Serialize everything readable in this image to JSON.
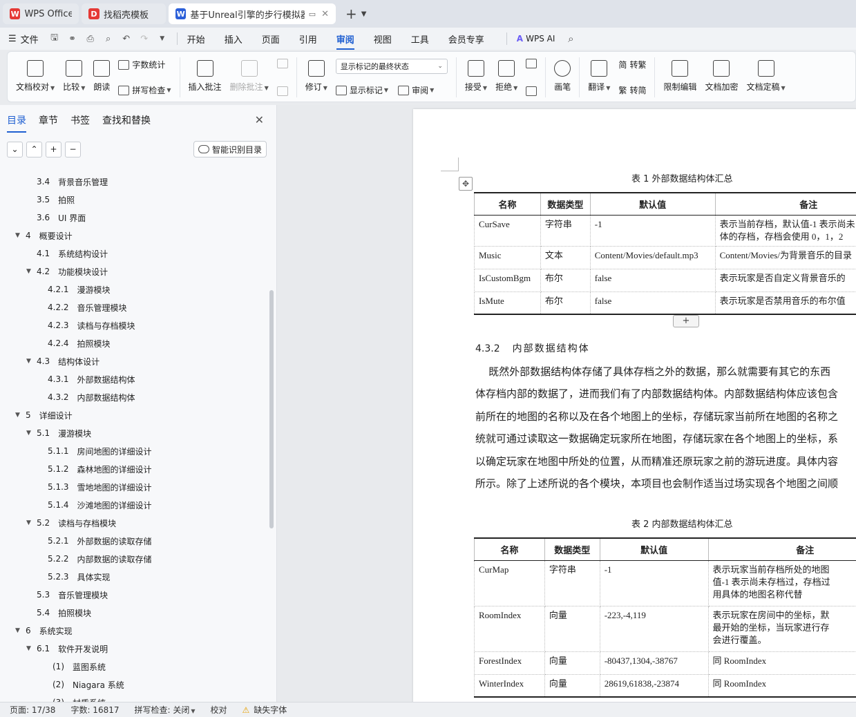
{
  "tabs": [
    {
      "label": "WPS Office",
      "icon": "wps-logo-icon",
      "color": "#e53935"
    },
    {
      "label": "找稻壳模板",
      "icon": "docer-logo-icon",
      "color": "#e53935"
    },
    {
      "label": "基于Unreal引擎的步行模拟器",
      "icon": "word-doc-icon",
      "color": "#2b5fd9"
    }
  ],
  "menu": {
    "file": "文件",
    "items": [
      "开始",
      "插入",
      "页面",
      "引用",
      "审阅",
      "视图",
      "工具",
      "会员专享"
    ],
    "active": "审阅",
    "wps_ai": "WPS AI"
  },
  "ribbon": {
    "doc_check": "文档校对",
    "compare": "比较",
    "read_aloud": "朗读",
    "word_count": "字数统计",
    "spell_check": "拼写检查",
    "insert_comment": "插入批注",
    "delete_comment": "删除批注",
    "revise": "修订",
    "markup_state": "显示标记的最终状态",
    "show_markup": "显示标记",
    "review": "审阅",
    "accept": "接受",
    "reject": "拒绝",
    "pen": "画笔",
    "translate": "翻译",
    "to_traditional": "转繁",
    "to_simplified": "转简",
    "restrict_edit": "限制编辑",
    "doc_encrypt": "文档加密",
    "doc_finalize": "文档定稿",
    "to_traditional_glyph": "简",
    "to_simplified_glyph": "繁"
  },
  "sidebar": {
    "tabs": [
      "目录",
      "章节",
      "书签",
      "查找和替换"
    ],
    "smart_toc": "智能识别目录",
    "toc": [
      {
        "num": "3.4",
        "text": "背景音乐管理",
        "level": 2
      },
      {
        "num": "3.5",
        "text": "拍照",
        "level": 2
      },
      {
        "num": "3.6",
        "text": "UI 界面",
        "level": 2
      },
      {
        "num": "4",
        "text": "概要设计",
        "level": 1,
        "expanded": true
      },
      {
        "num": "4.1",
        "text": "系统结构设计",
        "level": 2
      },
      {
        "num": "4.2",
        "text": "功能模块设计",
        "level": 2,
        "expanded": true
      },
      {
        "num": "4.2.1",
        "text": "漫游模块",
        "level": 3
      },
      {
        "num": "4.2.2",
        "text": "音乐管理模块",
        "level": 3
      },
      {
        "num": "4.2.3",
        "text": "读档与存档模块",
        "level": 3
      },
      {
        "num": "4.2.4",
        "text": "拍照模块",
        "level": 3
      },
      {
        "num": "4.3",
        "text": "结构体设计",
        "level": 2,
        "expanded": true
      },
      {
        "num": "4.3.1",
        "text": "外部数据结构体",
        "level": 3
      },
      {
        "num": "4.3.2",
        "text": "内部数据结构体",
        "level": 3
      },
      {
        "num": "5",
        "text": "详细设计",
        "level": 1,
        "expanded": true
      },
      {
        "num": "5.1",
        "text": "漫游模块",
        "level": 2,
        "expanded": true
      },
      {
        "num": "5.1.1",
        "text": "房间地图的详细设计",
        "level": 3
      },
      {
        "num": "5.1.2",
        "text": "森林地图的详细设计",
        "level": 3
      },
      {
        "num": "5.1.3",
        "text": "雪地地图的详细设计",
        "level": 3
      },
      {
        "num": "5.1.4",
        "text": "沙滩地图的详细设计",
        "level": 3
      },
      {
        "num": "5.2",
        "text": "读档与存档模块",
        "level": 2,
        "expanded": true
      },
      {
        "num": "5.2.1",
        "text": "外部数据的读取存储",
        "level": 3
      },
      {
        "num": "5.2.2",
        "text": "内部数据的读取存储",
        "level": 3
      },
      {
        "num": "5.2.3",
        "text": "具体实现",
        "level": 3
      },
      {
        "num": "5.3",
        "text": "音乐管理模块",
        "level": 2
      },
      {
        "num": "5.4",
        "text": "拍照模块",
        "level": 2
      },
      {
        "num": "6",
        "text": "系统实现",
        "level": 1,
        "expanded": true
      },
      {
        "num": "6.1",
        "text": "软件开发说明",
        "level": 2,
        "expanded": true
      },
      {
        "num": "(1)",
        "text": "蓝图系统",
        "level": 3
      },
      {
        "num": "(2)",
        "text": "Niagara 系统",
        "level": 3
      },
      {
        "num": "(3)",
        "text": "材质系统",
        "level": 3
      }
    ]
  },
  "document": {
    "table1": {
      "caption": "表 1  外部数据结构体汇总",
      "headers": [
        "名称",
        "数据类型",
        "默认值",
        "备注"
      ],
      "rows": [
        [
          "CurSave",
          "字符串",
          "-1",
          "表示当前存档，默认值-1 表示尚未\n体的存档，存档会使用 0，1，2"
        ],
        [
          "Music",
          "文本",
          "Content/Movies/default.mp3",
          "Content/Movies/为背景音乐的目录"
        ],
        [
          "IsCustomBgm",
          "布尔",
          "false",
          "表示玩家是否自定义背景音乐的"
        ],
        [
          "IsMute",
          "布尔",
          "false",
          "表示玩家是否禁用音乐的布尔值"
        ]
      ]
    },
    "section": {
      "num": "4.3.2",
      "title": "内部数据结构体"
    },
    "paragraph": [
      "    既然外部数据结构体存储了具体存档之外的数据，那么就需要有其它的东西",
      "体存档内部的数据了，进而我们有了内部数据结构体。内部数据结构体应该包含",
      "前所在的地图的名称以及在各个地图上的坐标，存储玩家当前所在地图的名称之",
      "统就可通过读取这一数据确定玩家所在地图，存储玩家在各个地图上的坐标，系",
      "以确定玩家在地图中所处的位置，从而精准还原玩家之前的游玩进度。具体内容",
      "所示。除了上述所说的各个模块，本项目也会制作适当过场实现各个地图之间顺"
    ],
    "table2": {
      "caption": "表 2  内部数据结构体汇总",
      "headers": [
        "名称",
        "数据类型",
        "默认值",
        "备注"
      ],
      "rows": [
        [
          "CurMap",
          "字符串",
          "-1",
          "表示玩家当前存档所处的地图\n值-1 表示尚未存档过，存档过\n用具体的地图名称代替"
        ],
        [
          "RoomIndex",
          "向量",
          "-223,-4,119",
          "表示玩家在房间中的坐标，默\n最开始的坐标，当玩家进行存\n会进行覆盖。"
        ],
        [
          "ForestIndex",
          "向量",
          "-80437,1304,-38767",
          "同 RoomIndex"
        ],
        [
          "WinterIndex",
          "向量",
          "28619,61838,-23874",
          "同 RoomIndex"
        ]
      ]
    }
  },
  "status": {
    "page": "页面: 17/38",
    "words": "字数: 16817",
    "spell": "拼写检查: 关闭",
    "proof": "校对",
    "missing_font": "缺失字体"
  }
}
